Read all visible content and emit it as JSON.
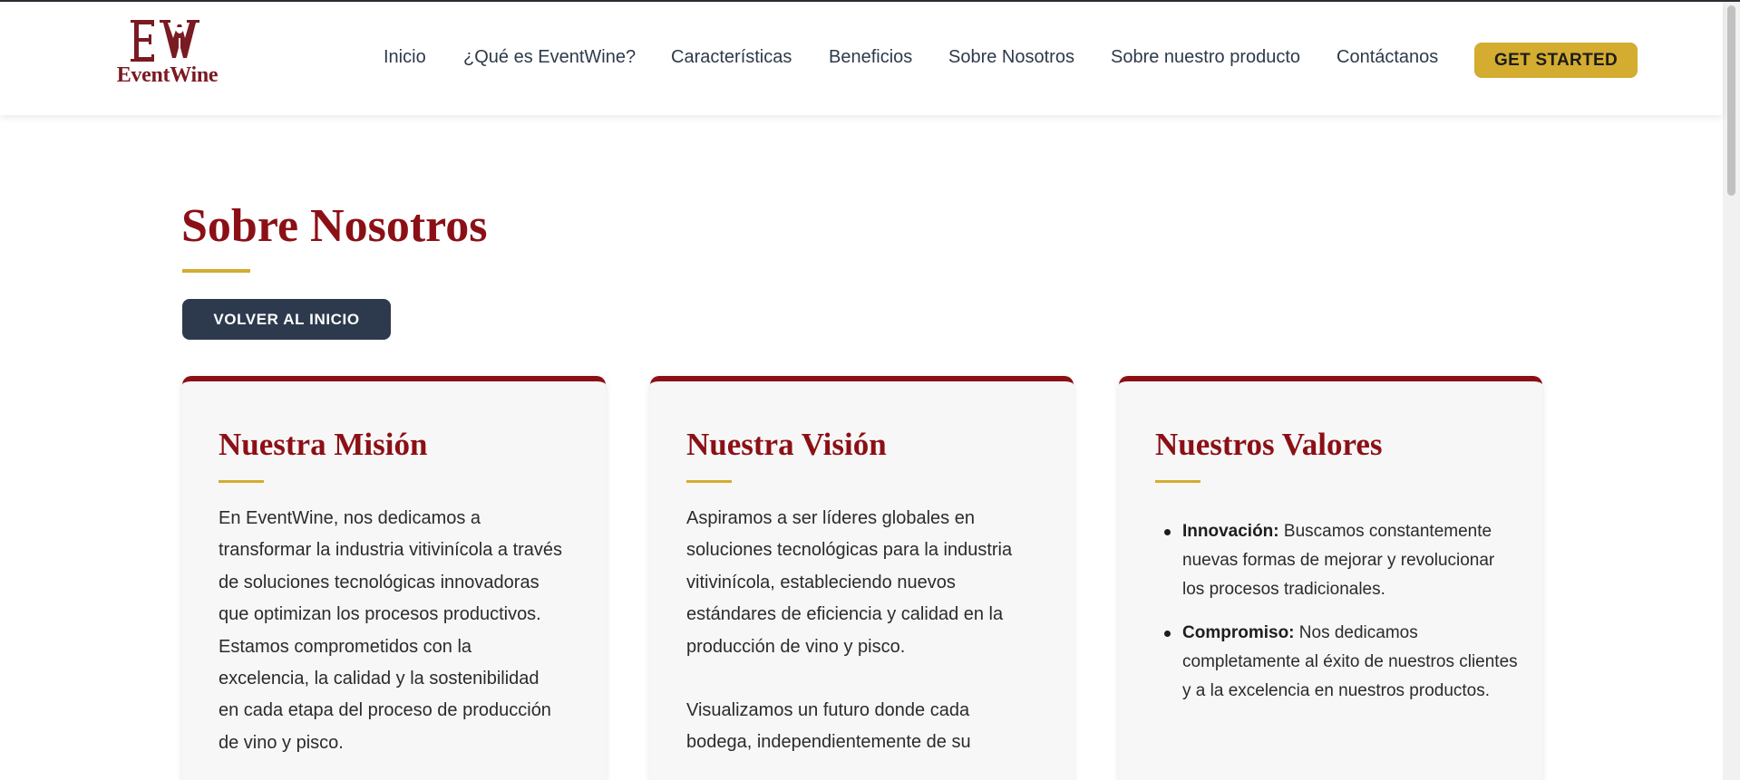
{
  "brand": {
    "name": "EventWine",
    "mark_color": "#7a1a22"
  },
  "nav": {
    "items": [
      {
        "label": "Inicio"
      },
      {
        "label": "¿Qué es EventWine?"
      },
      {
        "label": "Características"
      },
      {
        "label": "Beneficios"
      },
      {
        "label": "Sobre Nosotros"
      },
      {
        "label": "Sobre nuestro producto"
      },
      {
        "label": "Contáctanos"
      }
    ],
    "cta_label": "GET STARTED"
  },
  "page": {
    "title": "Sobre Nosotros",
    "back_button_label": "VOLVER AL INICIO"
  },
  "cards": {
    "mission": {
      "title": "Nuestra Misión",
      "paragraphs": [
        "En EventWine, nos dedicamos a transformar la industria vitivinícola a través de soluciones tecnológicas innovadoras que optimizan los procesos productivos. Estamos comprometidos con la excelencia, la calidad y la sostenibilidad en cada etapa del proceso de producción de vino y pisco."
      ]
    },
    "vision": {
      "title": "Nuestra Visión",
      "paragraphs": [
        "Aspiramos a ser líderes globales en soluciones tecnológicas para la industria vitivinícola, estableciendo nuevos estándares de eficiencia y calidad en la producción de vino y pisco.",
        "Visualizamos un futuro donde cada bodega, independientemente de su"
      ]
    },
    "values": {
      "title": "Nuestros Valores",
      "items": [
        {
          "term": "Innovación:",
          "text": "Buscamos constantemente nuevas formas de mejorar y revolucionar los procesos tradicionales."
        },
        {
          "term": "Compromiso:",
          "text": "Nos dedicamos completamente al éxito de nuestros clientes y a la excelencia en nuestros productos."
        }
      ]
    }
  },
  "colors": {
    "accent_red": "#8b1016",
    "accent_gold": "#d4ac2f",
    "dark_button": "#2d3a4d"
  }
}
